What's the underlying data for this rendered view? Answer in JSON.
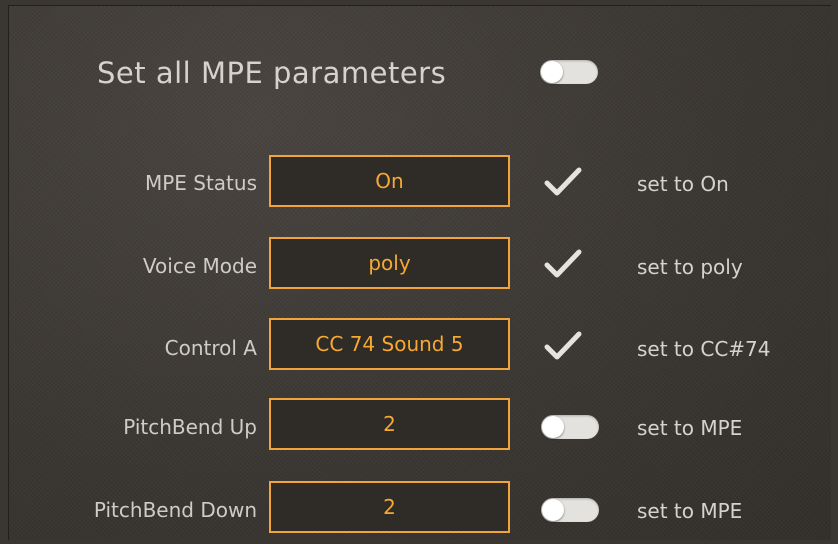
{
  "header": {
    "title": "Set all MPE parameters",
    "toggle_state": "off"
  },
  "rows": [
    {
      "label": "MPE Status",
      "value": "On",
      "indicator": "checkmark-icon",
      "note": "set to On"
    },
    {
      "label": "Voice Mode",
      "value": "poly",
      "indicator": "checkmark-icon",
      "note": "set to poly"
    },
    {
      "label": "Control A",
      "value": "CC 74 Sound 5",
      "indicator": "checkmark-icon",
      "note": "set to CC#74"
    },
    {
      "label": "PitchBend Up",
      "value": "2",
      "indicator": "toggle-off",
      "note": "set to MPE"
    },
    {
      "label": "PitchBend Down",
      "value": "2",
      "indicator": "toggle-off",
      "note": "set to MPE"
    }
  ],
  "colors": {
    "accent": "#f6a833",
    "background": "#3d3935",
    "text": "#d6d2cc"
  }
}
